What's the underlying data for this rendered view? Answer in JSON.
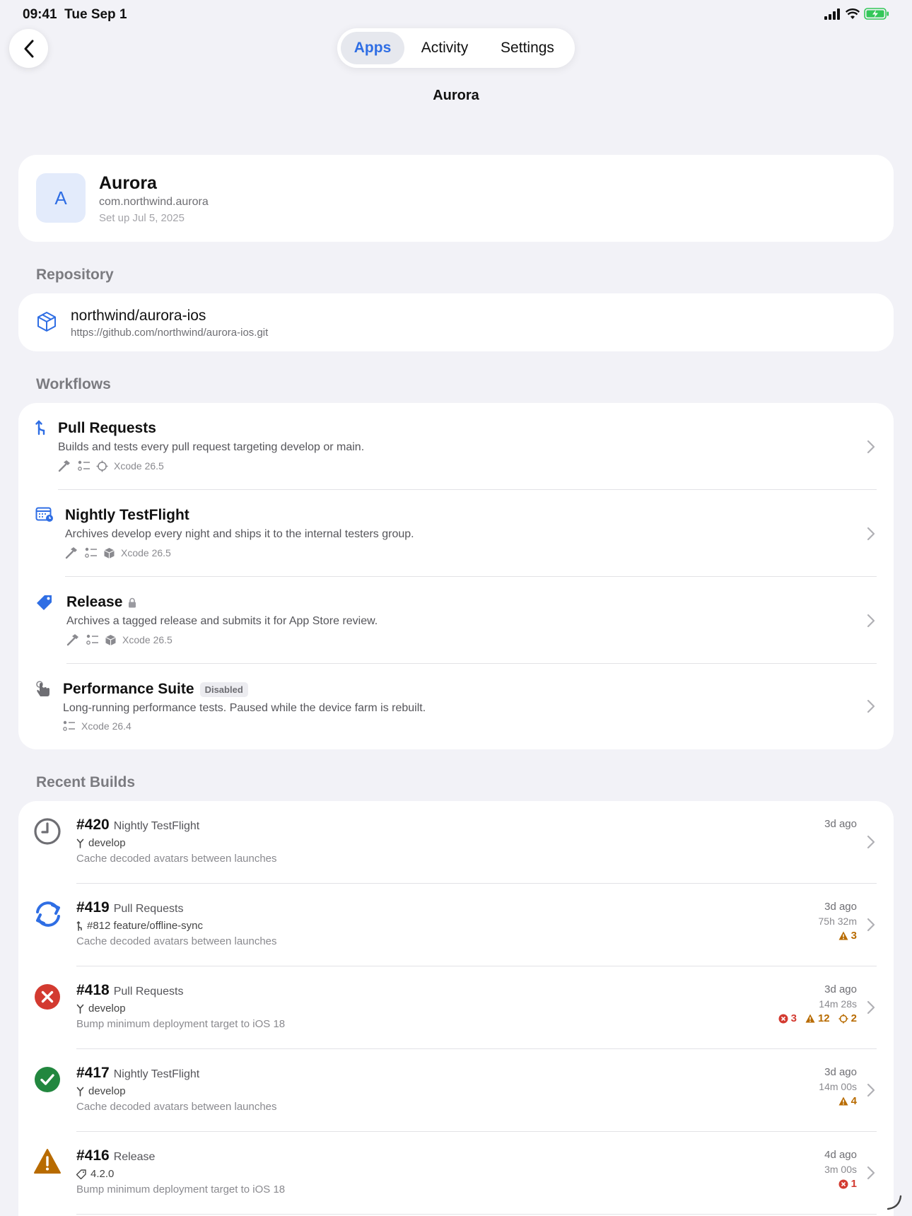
{
  "status_bar": {
    "time": "09:41",
    "date": "Tue Sep 1"
  },
  "nav": {
    "tabs": [
      {
        "label": "Apps",
        "active": true
      },
      {
        "label": "Activity",
        "active": false
      },
      {
        "label": "Settings",
        "active": false
      }
    ],
    "title": "Aurora"
  },
  "app": {
    "initial": "A",
    "name": "Aurora",
    "bundle_id": "com.northwind.aurora",
    "setup": "Set up Jul 5, 2025"
  },
  "repository": {
    "section_label": "Repository",
    "name": "northwind/aurora-ios",
    "url": "https://github.com/northwind/aurora-ios.git"
  },
  "workflows": {
    "section_label": "Workflows",
    "items": [
      {
        "name": "Pull Requests",
        "description": "Builds and tests every pull request targeting develop or main.",
        "xcode": "Xcode 26.5",
        "icon": "pull-request-icon",
        "locked": false,
        "badge": ""
      },
      {
        "name": "Nightly TestFlight",
        "description": "Archives develop every night and ships it to the internal testers group.",
        "xcode": "Xcode 26.5",
        "icon": "calendar-schedule-icon",
        "locked": false,
        "badge": ""
      },
      {
        "name": "Release",
        "description": "Archives a tagged release and submits it for App Store review.",
        "xcode": "Xcode 26.5",
        "icon": "tag-icon",
        "locked": true,
        "badge": ""
      },
      {
        "name": "Performance Suite",
        "description": "Long-running performance tests. Paused while the device farm is rebuilt.",
        "xcode": "Xcode 26.4",
        "icon": "tap-gesture-icon",
        "locked": false,
        "badge": "Disabled"
      }
    ]
  },
  "builds": {
    "section_label": "Recent Builds",
    "items": [
      {
        "number": "#420",
        "workflow": "Nightly TestFlight",
        "ref": "develop",
        "ref_type": "branch",
        "message": "Cache decoded avatars between launches",
        "time": "3d ago",
        "duration": "",
        "status": "queued",
        "errors": "",
        "warnings": "",
        "analyzer": ""
      },
      {
        "number": "#419",
        "workflow": "Pull Requests",
        "ref": "#812 feature/offline-sync",
        "ref_type": "pr",
        "message": "Cache decoded avatars between launches",
        "time": "3d ago",
        "duration": "75h 32m",
        "status": "running",
        "errors": "",
        "warnings": "3",
        "analyzer": ""
      },
      {
        "number": "#418",
        "workflow": "Pull Requests",
        "ref": "develop",
        "ref_type": "branch",
        "message": "Bump minimum deployment target to iOS 18",
        "time": "3d ago",
        "duration": "14m 28s",
        "status": "failed",
        "errors": "3",
        "warnings": "12",
        "analyzer": "2"
      },
      {
        "number": "#417",
        "workflow": "Nightly TestFlight",
        "ref": "develop",
        "ref_type": "branch",
        "message": "Cache decoded avatars between launches",
        "time": "3d ago",
        "duration": "14m 00s",
        "status": "succeeded",
        "errors": "",
        "warnings": "4",
        "analyzer": ""
      },
      {
        "number": "#416",
        "workflow": "Release",
        "ref": "4.2.0",
        "ref_type": "tag",
        "message": "Bump minimum deployment target to iOS 18",
        "time": "4d ago",
        "duration": "3m 00s",
        "status": "warning",
        "errors": "1",
        "warnings": "",
        "analyzer": ""
      }
    ]
  },
  "colors": {
    "accent": "#2f6ee4",
    "background": "#f2f2f7",
    "error": "#d33a30",
    "warning": "#b86b00",
    "success": "#22873f"
  }
}
